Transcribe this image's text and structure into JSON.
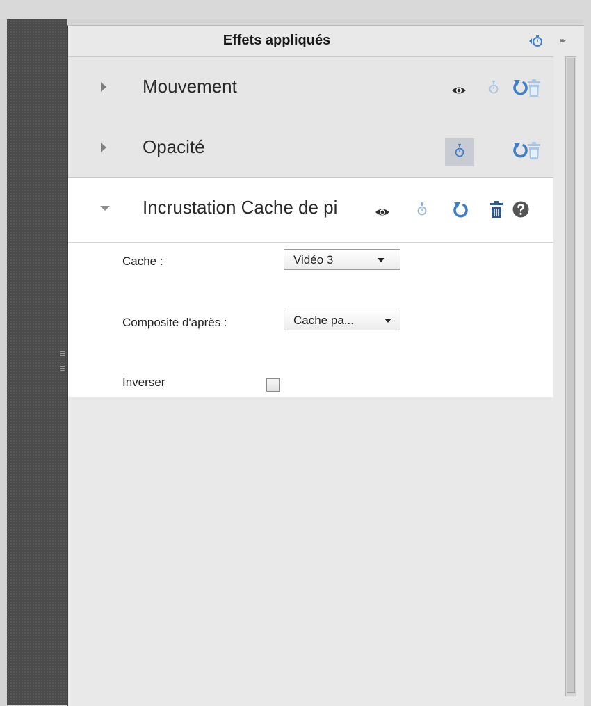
{
  "panel": {
    "title": "Effets appliqués",
    "header_icons": [
      "stopwatch-icon",
      "panel-expand-icon"
    ]
  },
  "effects": [
    {
      "name": "Mouvement",
      "expanded": false,
      "icons": [
        "eye-icon",
        "stopwatch-icon",
        "reset-icon",
        "trash-icon"
      ]
    },
    {
      "name": "Opacité",
      "expanded": false,
      "icons": [
        "eye-icon",
        "stopwatch-icon",
        "reset-icon",
        "trash-icon"
      ],
      "stopwatch_active": true
    },
    {
      "name": "Incrustation Cache de pi",
      "expanded": true,
      "icons": [
        "eye-icon",
        "stopwatch-icon",
        "reset-icon",
        "trash-icon",
        "help-icon"
      ],
      "params": {
        "cache_label": "Cache :",
        "cache_value": "Vidéo 3",
        "composite_label": "Composite d'après :",
        "composite_value": "Cache pa...",
        "invert_label": "Inverser",
        "invert_checked": false
      }
    }
  ],
  "colors": {
    "accent_blue": "#3d7fc9",
    "light_blue": "#8fb6e2",
    "icon_dark": "#2f2f2f",
    "trash_light": "#a9c6e4",
    "trash_dark": "#2f5b8a"
  }
}
